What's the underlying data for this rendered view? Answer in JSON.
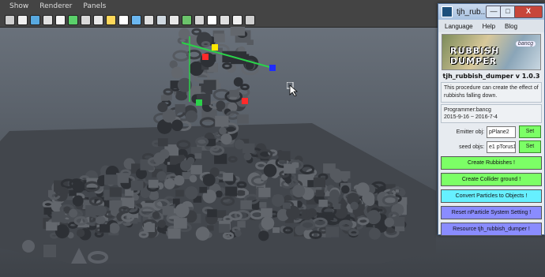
{
  "viewport_menu": [
    "Show",
    "Renderer",
    "Panels"
  ],
  "toolbar_colors": [
    "#cfcfcf",
    "#f0f0f0",
    "#58a9e0",
    "#e0e0e0",
    "#f6f6f6",
    "#5ad06a",
    "#d9d9d9",
    "#e8e8e8",
    "#ffd85a",
    "#ffffff",
    "#6bb7f0",
    "#e0e0e0",
    "#cfd8e0",
    "#e8e8e8",
    "#6bc46b",
    "#d6d6d6",
    "#ffffff",
    "#e0e0e0",
    "#efefef",
    "#cfcfcf"
  ],
  "plugin": {
    "window_title": "tjh_rub...",
    "minimize_glyph": "—",
    "maximize_glyph": "□",
    "close_glyph": "X",
    "menu": [
      "Language",
      "Help",
      "Blog"
    ],
    "banner_logo": "RUBBISH DUMPER",
    "banner_brand": "bancg",
    "version": "tjh_rubbish_dumper v 1.0.3",
    "description": "This procedure can create the effect of rubbishs falling down.",
    "programmer": "Programmer:bancg",
    "dates": "2015-9-16 ~ 2016-7-4",
    "emitter_label": "Emitter obj:",
    "emitter_value": "pPlane2",
    "seed_label": "seed objs:",
    "seed_value": "e1 pTorus1",
    "set_label": "Set",
    "buttons": [
      "Create Rubbishes !",
      "Create Collider ground !",
      "Convert Particles to Objects !",
      "Reset nParticle System Setting !",
      "Resource tjh_rubbish_dumper !"
    ]
  }
}
